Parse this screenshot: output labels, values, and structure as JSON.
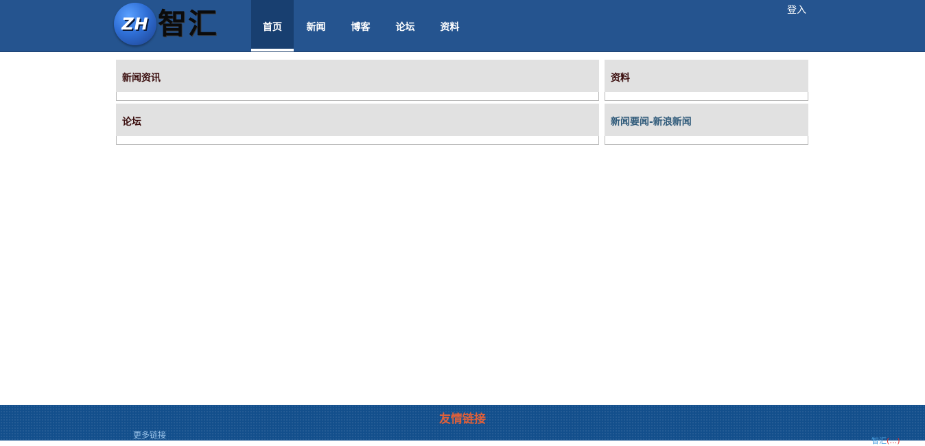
{
  "header": {
    "logo_mark": "ZH",
    "logo_name": "智汇",
    "nav": [
      {
        "label": "首页",
        "active": true
      },
      {
        "label": "新闻",
        "active": false
      },
      {
        "label": "博客",
        "active": false
      },
      {
        "label": "论坛",
        "active": false
      },
      {
        "label": "资料",
        "active": false
      }
    ],
    "login_label": "登入"
  },
  "panels": {
    "news": {
      "title": "新闻资讯"
    },
    "resources": {
      "title": "资料"
    },
    "forum": {
      "title": "论坛"
    },
    "sina": {
      "title": "新闻要闻-新浪新闻"
    }
  },
  "footer": {
    "title": "友情链接",
    "more_links": "更多链接",
    "corner_text_a": "智汇",
    "corner_text_b": "(…)"
  },
  "colors": {
    "header_bg": "#25548f",
    "nav_active_bg": "#183f70",
    "panel_head_bg": "#e1e1e1",
    "footer_bg": "#134f8c",
    "footer_title": "#e0603a"
  }
}
